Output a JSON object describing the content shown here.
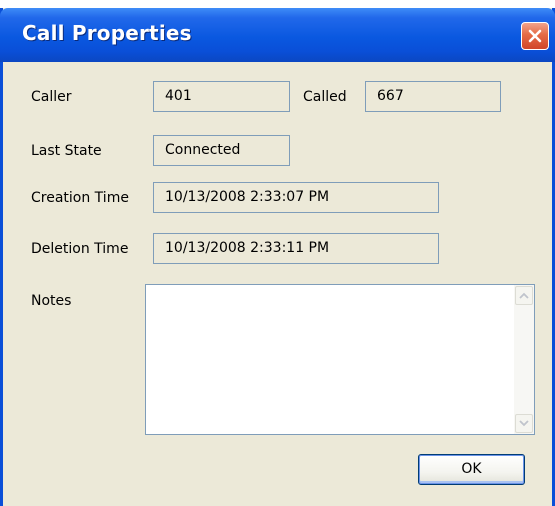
{
  "window": {
    "title": "Call Properties"
  },
  "labels": {
    "caller": "Caller",
    "called": "Called",
    "last_state": "Last State",
    "creation_time": "Creation Time",
    "deletion_time": "Deletion Time",
    "notes": "Notes"
  },
  "values": {
    "caller": "401",
    "called": "667",
    "last_state": "Connected",
    "creation_time": "10/13/2008 2:33:07 PM",
    "deletion_time": "10/13/2008 2:33:11 PM",
    "notes": ""
  },
  "buttons": {
    "ok": "OK"
  },
  "icons": {
    "close": "close-x-icon",
    "scroll_up": "scroll-up-arrow-icon",
    "scroll_down": "scroll-down-arrow-icon"
  },
  "colors": {
    "titlebar": "#0a58e0",
    "close_button": "#e56a45",
    "dialog_background": "#ece9d8",
    "field_border": "#7f9db9"
  }
}
